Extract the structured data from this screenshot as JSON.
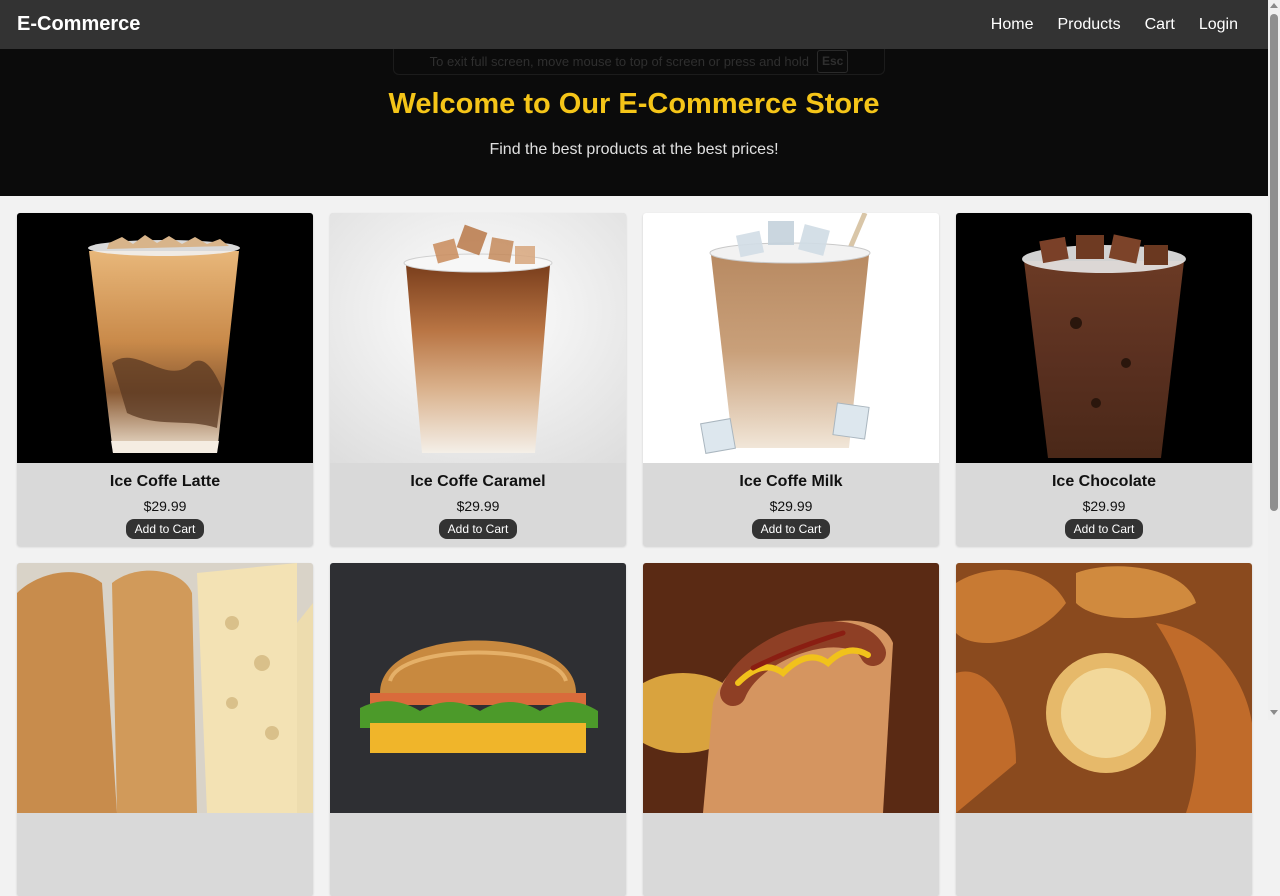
{
  "navbar": {
    "brand": "E-Commerce",
    "links": [
      "Home",
      "Products",
      "Cart",
      "Login"
    ]
  },
  "fullscreen_notice": {
    "text": "To exit full screen, move mouse to top of screen or press and hold",
    "key": "Esc"
  },
  "hero": {
    "title": "Welcome to Our E-Commerce Store",
    "subtitle": "Find the best products at the best prices!"
  },
  "products": [
    {
      "name": "Ice Coffe Latte",
      "price": "$29.99",
      "button": "Add to Cart",
      "image": "iced-latte-photo"
    },
    {
      "name": "Ice Coffe Caramel",
      "price": "$29.99",
      "button": "Add to Cart",
      "image": "iced-caramel-photo"
    },
    {
      "name": "Ice Coffe Milk",
      "price": "$29.99",
      "button": "Add to Cart",
      "image": "iced-milk-coffee-photo"
    },
    {
      "name": "Ice Chocolate",
      "price": "$29.99",
      "button": "Add to Cart",
      "image": "iced-chocolate-photo"
    },
    {
      "image": "bread-photo"
    },
    {
      "image": "burger-photo"
    },
    {
      "image": "hotdog-photo"
    },
    {
      "image": "croissant-photo"
    }
  ],
  "colors": {
    "navbar_bg": "#333333",
    "hero_bg": "#0b0b0b",
    "hero_title": "#f5c518",
    "card_bg": "#d9d9d9",
    "button_bg": "#333333"
  }
}
